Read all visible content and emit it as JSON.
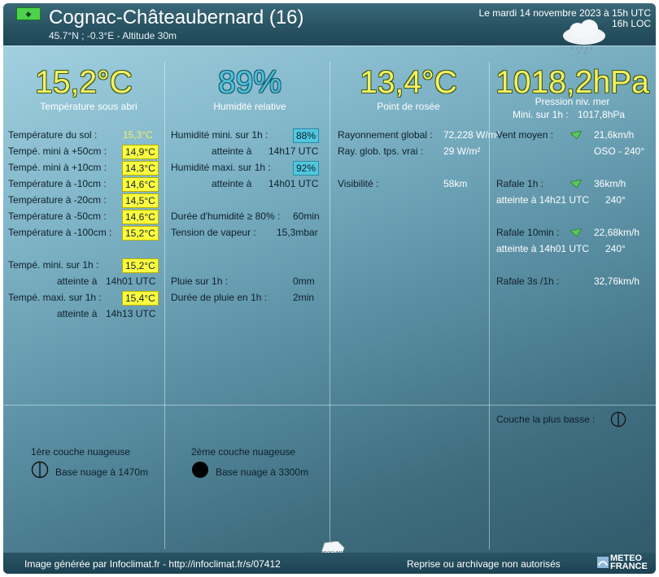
{
  "header": {
    "station": "Cognac-Châteaubernard (16)",
    "coords": "45.7°N ; -0.3°E - Altitude 30m",
    "date_line1": "Le mardi 14 novembre 2023 à 15h UTC",
    "date_line2": "16h LOC",
    "flag_icon": "green-diamond-flag-icon",
    "weather_icon": "cloud-drizzle-icon"
  },
  "big": {
    "temp": {
      "value": "15,2°C",
      "label": "Température sous abri"
    },
    "hum": {
      "value": "89%",
      "label": "Humidité relative"
    },
    "dew": {
      "value": "13,4°C",
      "label": "Point de rosée"
    },
    "press": {
      "value": "1018,2hPa",
      "label": "Pression niv. mer",
      "sub_label": "Mini. sur 1h :",
      "sub_value": "1017,8hPa"
    }
  },
  "col1": {
    "sol_label": "Température du sol :",
    "sol_value": "15,3°C",
    "rows": [
      {
        "label": "Tempé. mini à +50cm :",
        "value": "14,9°C"
      },
      {
        "label": "Tempé. mini à +10cm :",
        "value": "14,3°C"
      },
      {
        "label": "Température à -10cm :",
        "value": "14,6°C"
      },
      {
        "label": "Température à -20cm :",
        "value": "14,5°C"
      },
      {
        "label": "Température à -50cm :",
        "value": "14,6°C"
      },
      {
        "label": "Température à -100cm :",
        "value": "15,2°C"
      }
    ],
    "mini_label": "Tempé. mini. sur 1h :",
    "mini_value": "15,2°C",
    "mini_at_label": "atteinte à",
    "mini_at_value": "14h01 UTC",
    "maxi_label": "Tempé. maxi. sur 1h :",
    "maxi_value": "15,4°C",
    "maxi_at_label": "atteinte à",
    "maxi_at_value": "14h13 UTC"
  },
  "col2": {
    "hmin_label": "Humidité mini. sur 1h :",
    "hmin_value": "88%",
    "hmin_at_label": "atteinte à",
    "hmin_at_value": "14h17 UTC",
    "hmax_label": "Humidité maxi. sur 1h :",
    "hmax_value": "92%",
    "hmax_at_label": "atteinte à",
    "hmax_at_value": "14h01 UTC",
    "dur_label": "Durée d'humidité ≥ 80% :",
    "dur_value": "60min",
    "tens_label": "Tension de vapeur :",
    "tens_value": "15,3mbar",
    "rain_label": "Pluie sur 1h :",
    "rain_value": "0mm",
    "rdur_label": "Durée de pluie en 1h :",
    "rdur_value": "2min"
  },
  "col3": {
    "rg_label": "Rayonnement global :",
    "rg_value": "72,228 W/m²",
    "rv_label": "Ray. glob. tps. vrai :",
    "rv_value": "29 W/m²",
    "vis_label": "Visibilité :",
    "vis_value": "58km"
  },
  "col4": {
    "vent_label": "Vent moyen :",
    "vent_value": "21,6km/h",
    "vent_dir": "OSO - 240°",
    "r1_label": "Rafale 1h :",
    "r1_value": "36km/h",
    "r1_at": "atteinte à 14h21 UTC",
    "r1_dir": "240°",
    "r10_label": "Rafale 10min :",
    "r10_value": "22,68km/h",
    "r10_at": "atteinte à 14h01 UTC",
    "r10_dir": "240°",
    "r3_label": "Rafale 3s /1h :",
    "r3_value": "32,76km/h",
    "couche_label": "Couche la plus basse :"
  },
  "clouds": {
    "c1_title": "1ère couche nuageuse",
    "c1_base": "Base nuage à 1470m",
    "c2_title": "2ème couche nuageuse",
    "c2_base": "Base nuage à 3300m"
  },
  "footer": {
    "left": "Image générée par Infoclimat.fr - http://infoclimat.fr/s/07412",
    "right": "Reprise ou archivage non autorisés",
    "mf_line1": "METEO",
    "mf_line2": "FRANCE",
    "ic_label": "INFOCLIMAT"
  }
}
